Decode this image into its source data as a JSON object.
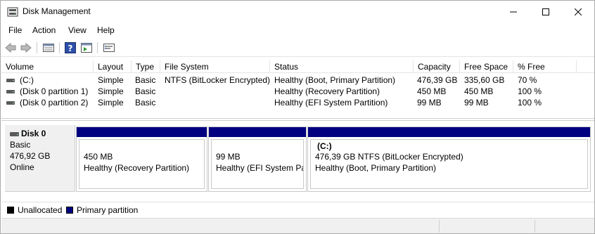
{
  "window": {
    "title": "Disk Management"
  },
  "menu": [
    "File",
    "Action",
    "View",
    "Help"
  ],
  "toolbar": {
    "icons": [
      "back-arrow-icon",
      "forward-arrow-icon",
      "disk-list-icon",
      "help-icon",
      "properties-icon",
      "settings-list-icon"
    ]
  },
  "table": {
    "columns": [
      "Volume",
      "Layout",
      "Type",
      "File System",
      "Status",
      "Capacity",
      "Free Space",
      "% Free"
    ],
    "rows": [
      [
        "(C:)",
        "Simple",
        "Basic",
        "NTFS (BitLocker Encrypted)",
        "Healthy (Boot, Primary Partition)",
        "476,39 GB",
        "335,60 GB",
        "70 %"
      ],
      [
        "(Disk 0 partition 1)",
        "Simple",
        "Basic",
        "",
        "Healthy (Recovery Partition)",
        "450 MB",
        "450 MB",
        "100 %"
      ],
      [
        "(Disk 0 partition 2)",
        "Simple",
        "Basic",
        "",
        "Healthy (EFI System Partition)",
        "99 MB",
        "99 MB",
        "100 %"
      ]
    ]
  },
  "disk": {
    "name": "Disk 0",
    "type": "Basic",
    "size": "476,92 GB",
    "state": "Online",
    "partitions": [
      {
        "title": "",
        "size": "450 MB",
        "status": "Healthy (Recovery Partition)"
      },
      {
        "title": "",
        "size": "99 MB",
        "status": "Healthy (EFI System Par"
      },
      {
        "title": "(C:)",
        "size": "476,39 GB NTFS (BitLocker Encrypted)",
        "status": "Healthy (Boot, Primary Partition)"
      }
    ]
  },
  "legend": [
    {
      "label": "Unallocated",
      "color": "#000000"
    },
    {
      "label": "Primary partition",
      "color": "#000080"
    }
  ],
  "colors": {
    "primary_partition": "#000080",
    "unallocated": "#000000"
  }
}
